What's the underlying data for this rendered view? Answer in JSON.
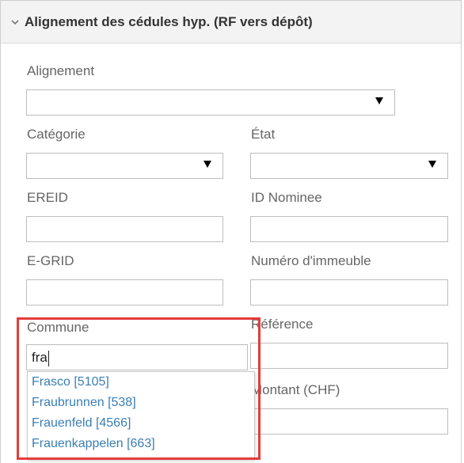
{
  "panel": {
    "title": "Alignement des cédules hyp. (RF vers dépôt)",
    "collapse_icon": "chevron-down-icon"
  },
  "fields": {
    "alignement": {
      "label": "Alignement",
      "value": ""
    },
    "categorie": {
      "label": "Catégorie",
      "value": ""
    },
    "etat": {
      "label": "État",
      "value": ""
    },
    "ereid": {
      "label": "EREID",
      "value": ""
    },
    "id_nominee": {
      "label": "ID Nominee",
      "value": ""
    },
    "egrid": {
      "label": "E-GRID",
      "value": ""
    },
    "numero_immeuble": {
      "label": "Numéro d'immeuble",
      "value": ""
    },
    "commune": {
      "label": "Commune",
      "value": "fra"
    },
    "reference": {
      "label": "Référence",
      "value": ""
    },
    "montant": {
      "label": "Montant (CHF)",
      "value": ""
    }
  },
  "autocomplete": {
    "options": [
      "Frasco [5105]",
      "Fraubrunnen [538]",
      "Frauenfeld [4566]",
      "Frauenkappelen [663]"
    ]
  },
  "colors": {
    "highlight": "#e53b3b",
    "link": "#3a7fb5"
  }
}
